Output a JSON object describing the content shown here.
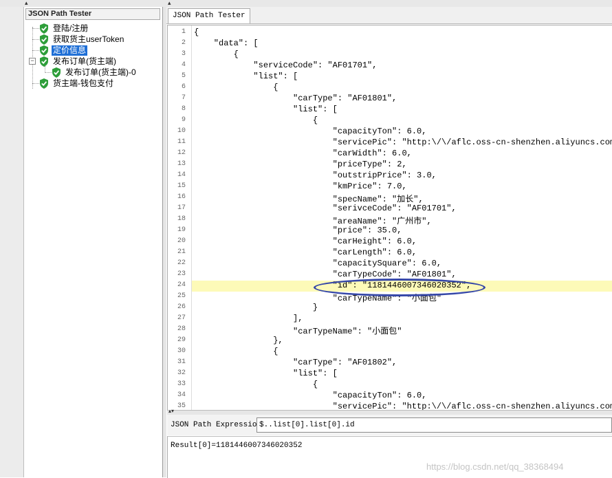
{
  "left_panel": {
    "title": "JSON Path Tester",
    "tree": [
      {
        "label": "登陆/注册"
      },
      {
        "label": "获取货主userToken"
      },
      {
        "label": "定价信息"
      },
      {
        "label": "发布订单(货主端)"
      },
      {
        "label": "发布订单(货主端)-0"
      },
      {
        "label": "货主端-钱包支付"
      }
    ]
  },
  "right_panel": {
    "tab": "JSON Path Tester",
    "code_lines": [
      "{",
      "    \"data\": [",
      "        {",
      "            \"serviceCode\": \"AF01701\",",
      "            \"list\": [",
      "                {",
      "                    \"carType\": \"AF01801\",",
      "                    \"list\": [",
      "                        {",
      "                            \"capacityTon\": 6.0,",
      "                            \"servicePic\": \"http:\\/\\/aflc.oss-cn-shenzhen.aliyuncs.com\\/",
      "                            \"carWidth\": 6.0,",
      "                            \"priceType\": 2,",
      "                            \"outstripPrice\": 3.0,",
      "                            \"kmPrice\": 7.0,",
      "                            \"specName\": \"加长\",",
      "                            \"serivceCode\": \"AF01701\",",
      "                            \"areaName\": \"广州市\",",
      "                            \"price\": 35.0,",
      "                            \"carHeight\": 6.0,",
      "                            \"carLength\": 6.0,",
      "                            \"capacitySquare\": 6.0,",
      "                            \"carTypeCode\": \"AF01801\",",
      "                            \"id\": \"1181446007346020352\",",
      "                            \"carTypeName\": \"小面包\"",
      "                        }",
      "                    ],",
      "                    \"carTypeName\": \"小面包\"",
      "                },",
      "                {",
      "                    \"carType\": \"AF01802\",",
      "                    \"list\": [",
      "                        {",
      "                            \"capacityTon\": 6.0,",
      "                            \"servicePic\": \"http:\\/\\/aflc.oss-cn-shenzhen.aliyuncs.com\\/"
    ],
    "line_numbers": [
      "1",
      "2",
      "3",
      "4",
      "5",
      "6",
      "7",
      "8",
      "9",
      "10",
      "11",
      "12",
      "13",
      "14",
      "15",
      "16",
      "17",
      "18",
      "19",
      "20",
      "21",
      "22",
      "23",
      "24",
      "25",
      "26",
      "27",
      "28",
      "29",
      "30",
      "31",
      "32",
      "33",
      "34",
      "35"
    ],
    "highlighted_line": "24",
    "expression_label": "JSON Path Expression",
    "expression_value": "$..list[0].list[0].id",
    "result_text": "Result[0]=1181446007346020352",
    "watermark": "https://blog.csdn.net/qq_38368494"
  },
  "colors": {
    "highlight": "#fdfab8",
    "ellipse": "#3547a8",
    "selection": "#1f6fd6",
    "shield": "#2e9e3a"
  },
  "icons": {
    "tree_item": "green-shield-check-icon",
    "header_chevron": "chevron-down-icon"
  }
}
